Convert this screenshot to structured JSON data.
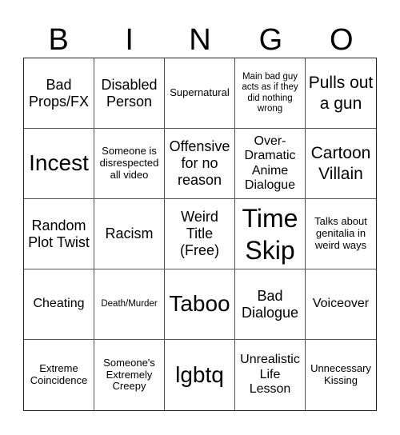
{
  "header": {
    "letters": [
      "B",
      "I",
      "N",
      "G",
      "O"
    ]
  },
  "cells": [
    "Bad Props/FX",
    "Disabled Person",
    "Supernatural",
    "Main bad guy acts as if they did nothing wrong",
    "Pulls out a gun",
    "Incest",
    "Someone is disrespected all video",
    "Offensive for no reason",
    "Over-Dramatic Anime Dialogue",
    "Cartoon Villain",
    "Random Plot Twist",
    "Racism",
    "Weird Title (Free)",
    "Time Skip",
    "Talks about genitalia in weird ways",
    "Cheating",
    "Death/Murder",
    "Taboo",
    "Bad Dialogue",
    "Voiceover",
    "Extreme Coincidence",
    "Someone's Extremely Creepy",
    "lgbtq",
    "Unrealistic Life Lesson",
    "Unnecessary Kissing"
  ]
}
